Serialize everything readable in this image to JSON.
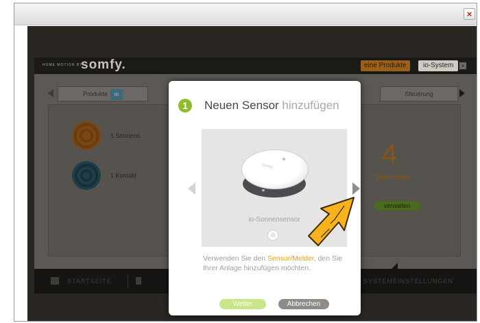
{
  "window": {
    "close_label": "×"
  },
  "app": {
    "tagline": "HOME MOTION BY",
    "logo": "somfy.",
    "products_button": "eine Produkte",
    "io_system_button": "io-System",
    "close_label": "×",
    "tabs": [
      {
        "label": "Produkte",
        "badge": "io"
      },
      {
        "label": "Steuerung"
      }
    ],
    "sensors": [
      {
        "label": "1 Sonnens",
        "icon": "sun-sensor-icon"
      },
      {
        "label": "1 Kontakt",
        "icon": "contact-sensor-icon"
      }
    ],
    "sensor_count": "4",
    "sensor_count_label": "Sensoren",
    "manage_button": "verwalten",
    "nav": {
      "home": "STARTSEITE",
      "system": "SYSTEMEINSTELLUNGEN"
    }
  },
  "modal": {
    "step": "1",
    "title_main": "Neuen Sensor",
    "title_accent": "hinzufügen",
    "product_name": "io-Sonnensensor",
    "device_brand": "somfy",
    "instruction_before": "Verwenden Sie den ",
    "instruction_highlight": "Sensor/Melder",
    "instruction_after": ", den Sie Ihrer Anlage hinzufügen möchten.",
    "next_button": "Weiter",
    "cancel_button": "Abbrechen"
  },
  "colors": {
    "accent_green": "#8dbd2c",
    "accent_orange": "#f0a000",
    "pointer_orange": "#f7b21c"
  }
}
